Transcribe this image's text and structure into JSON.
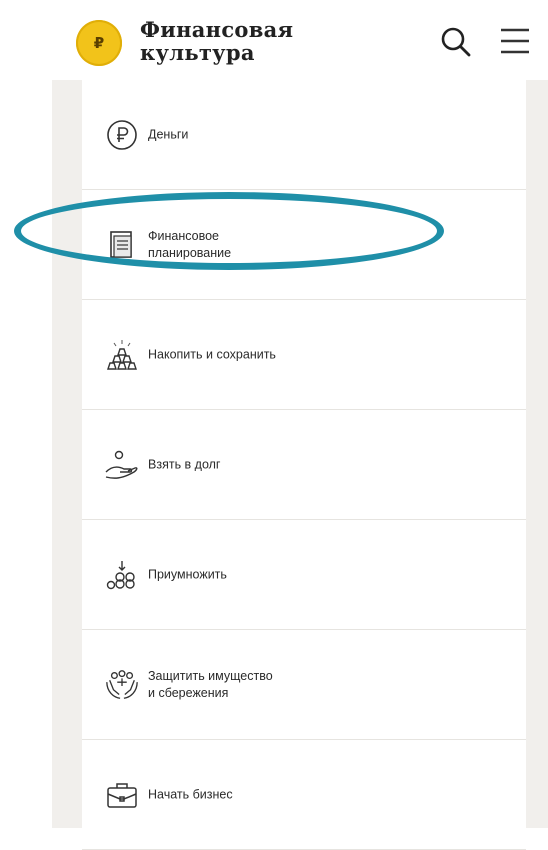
{
  "header": {
    "logo_symbol": "₽",
    "logo_line1": "Финансовая",
    "logo_line2": "культура",
    "search_icon": "search-icon",
    "menu_icon": "hamburger-menu-icon"
  },
  "menu": {
    "items": [
      {
        "label": "Деньги",
        "icon": "ruble-circle-icon"
      },
      {
        "label": "Финансовое\nпланирование",
        "icon": "document-icon"
      },
      {
        "label": "Накопить и сохранить",
        "icon": "gold-bars-icon"
      },
      {
        "label": "Взять в долг",
        "icon": "hand-coin-icon"
      },
      {
        "label": "Приумножить",
        "icon": "coin-stacks-icon"
      },
      {
        "label": "Защитить имущество\nи сбережения",
        "icon": "protect-hands-icon"
      },
      {
        "label": "Начать бизнес",
        "icon": "briefcase-icon"
      }
    ]
  },
  "highlight": {
    "color": "#1f8fa8",
    "target": "Финансовое планирование"
  },
  "colors": {
    "logo_coin": "#f2c31a",
    "side_panel": "#f1efec",
    "divider": "#e6e4e0"
  }
}
